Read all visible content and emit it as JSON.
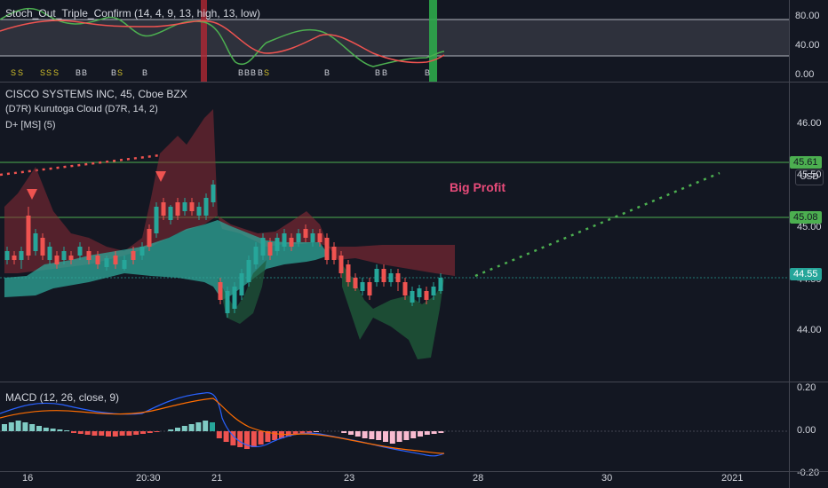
{
  "stoch": {
    "title": "Stoch_Out_Triple_Confirm (14, 4, 9, 13, high, 13, low)",
    "axis_ticks": [
      "80.00",
      "40.00",
      "0.00"
    ],
    "signals": [
      "S",
      "S",
      "S",
      "S",
      "S",
      "B",
      "B",
      "B",
      "S",
      "B",
      "B",
      "B",
      "B",
      "B",
      "S",
      "B",
      "B",
      "B",
      "B"
    ]
  },
  "main": {
    "symbol": "CISCO SYSTEMS INC, 45, Cboe BZX",
    "indicator1": "(D7R) Kurutoga Cloud (D7R, 14, 2)",
    "indicator2": "D+ [MS] (5)",
    "currency": "USD",
    "axis_ticks": [
      "46.00",
      "45.50",
      "45.00",
      "44.50",
      "44.00"
    ],
    "level_high": "45.61",
    "level_mid": "45.08",
    "last_price": "44.55",
    "annotation": "Big Profit"
  },
  "macd": {
    "title": "MACD (12, 26, close, 9)",
    "axis_ticks": [
      "0.20",
      "0.00",
      "-0.20"
    ]
  },
  "time_axis": {
    "ticks": [
      "16",
      "20:30",
      "21",
      "23",
      "28",
      "30",
      "2021"
    ]
  },
  "colors": {
    "background": "#131722",
    "green_level": "#4caf50",
    "teal": "#26a69a",
    "red": "#ef5350",
    "annotation": "#e84b7a"
  }
}
